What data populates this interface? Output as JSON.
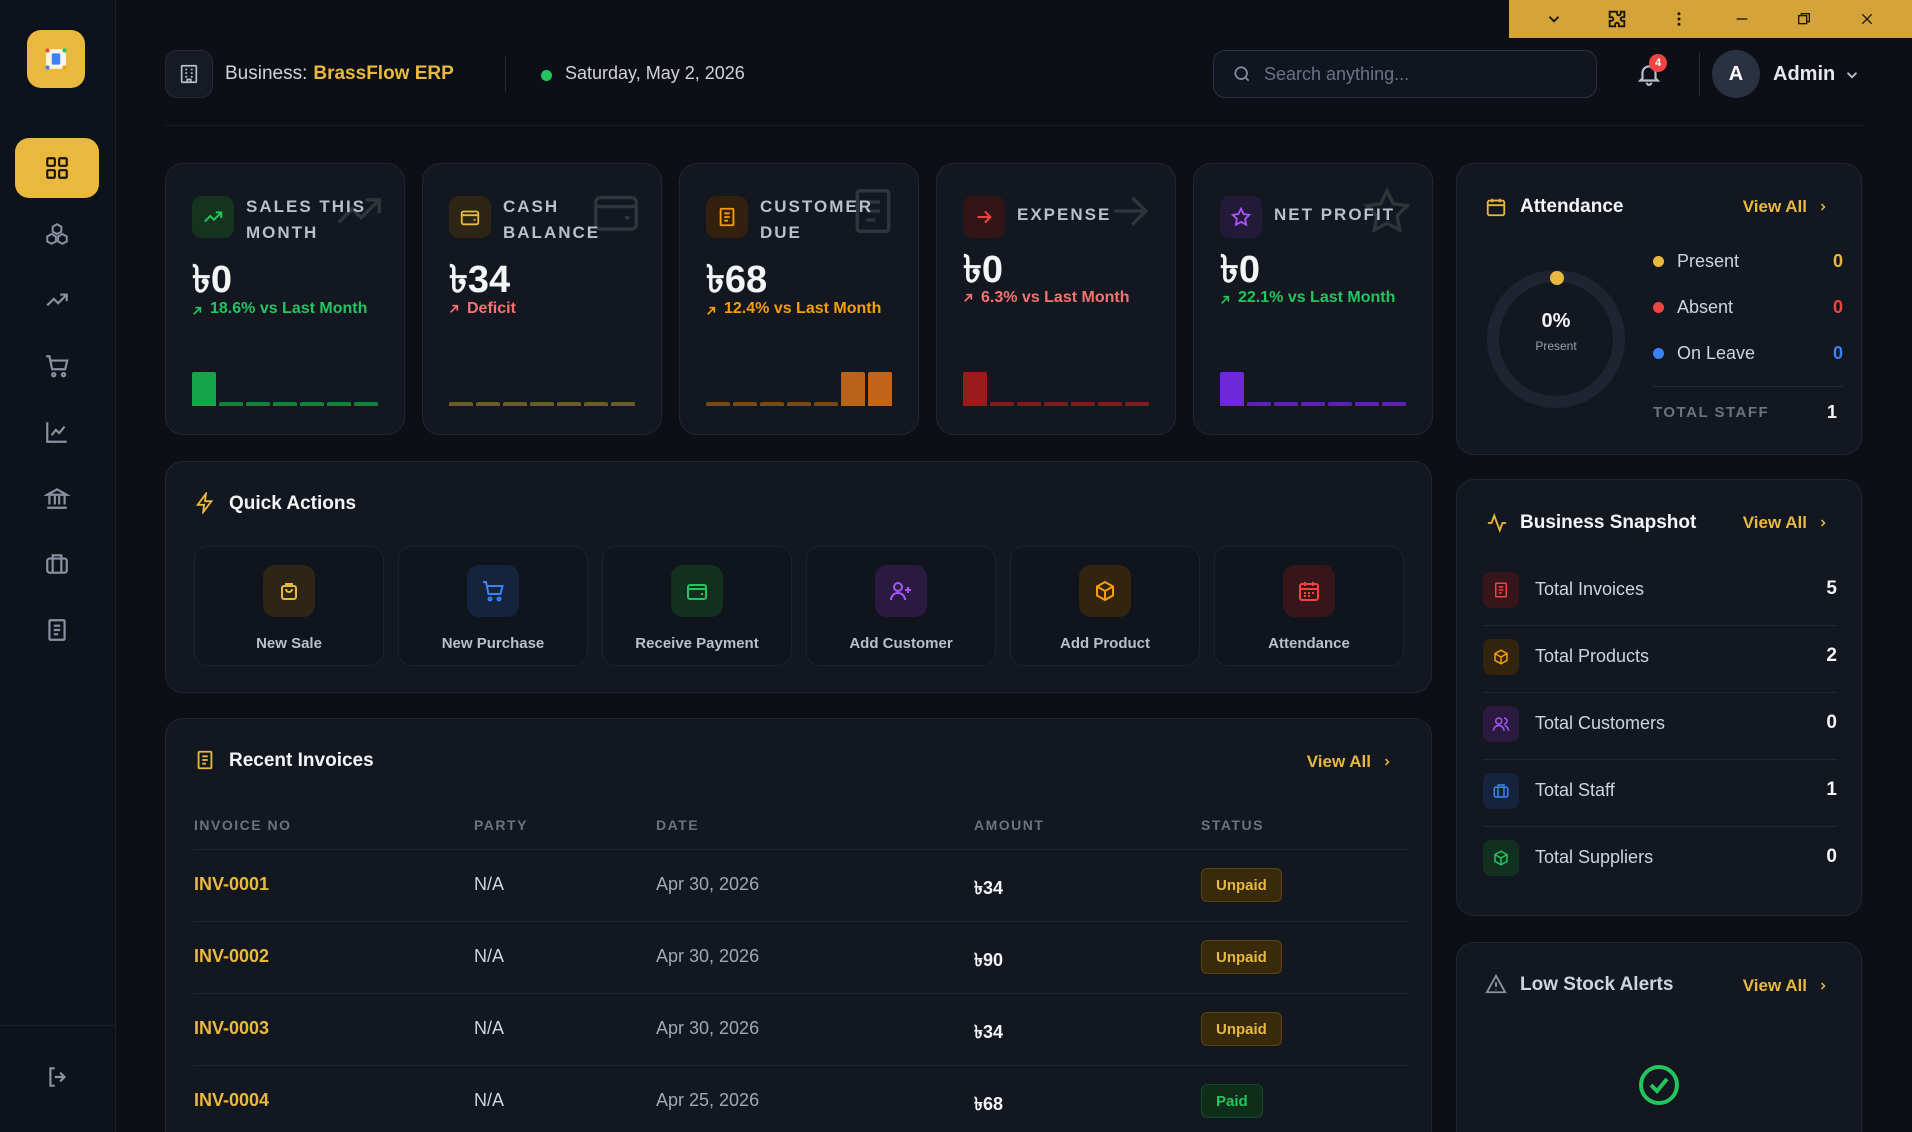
{
  "window": {
    "controls": [
      "chevron-down-icon",
      "extension-icon",
      "more-vert-icon",
      "minimize-icon",
      "restore-icon",
      "close-icon"
    ]
  },
  "sidebar": {
    "items": [
      "dashboard-icon",
      "inventory-icon",
      "sales-trend-icon",
      "purchase-cart-icon",
      "reports-chart-icon",
      "bank-icon",
      "staff-briefcase-icon",
      "invoice-doc-icon"
    ],
    "active_index": 0,
    "logout": "logout-icon"
  },
  "header": {
    "business_label": "Business:",
    "business_name": "BrassFlow ERP",
    "date": "Saturday, May 2, 2026",
    "search_placeholder": "Search anything...",
    "notification_count": "4",
    "avatar_letter": "A",
    "user_name": "Admin"
  },
  "stats": [
    {
      "label": "SALES THIS MONTH",
      "value": "৳0",
      "change": "18.6% vs Last Month",
      "change_color": "#22c55e",
      "accent": "#22c55e"
    },
    {
      "label": "CASH BALANCE",
      "value": "৳34",
      "change": "Deficit",
      "change_color": "#f87171",
      "accent": "#a1883f"
    },
    {
      "label": "CUSTOMER DUE",
      "value": "৳68",
      "change": "12.4% vs Last Month",
      "change_color": "#f59e0b",
      "accent": "#f59e0b"
    },
    {
      "label": "EXPENSE",
      "value": "৳0",
      "change": "6.3% vs Last Month",
      "change_color": "#f87171",
      "accent": "#ef4444"
    },
    {
      "label": "NET PROFIT",
      "value": "৳0",
      "change": "22.1% vs Last Month",
      "change_color": "#22c55e",
      "accent": "#8b5cf6"
    }
  ],
  "quick_actions": {
    "title": "Quick Actions",
    "items": [
      {
        "label": "New Sale",
        "color": "#e8b93e"
      },
      {
        "label": "New Purchase",
        "color": "#3b82f6"
      },
      {
        "label": "Receive Payment",
        "color": "#22c55e"
      },
      {
        "label": "Add Customer",
        "color": "#a855f7"
      },
      {
        "label": "Add Product",
        "color": "#f59e0b"
      },
      {
        "label": "Attendance",
        "color": "#ef4444"
      }
    ]
  },
  "invoices": {
    "title": "Recent Invoices",
    "view_all": "View All",
    "columns": [
      "INVOICE NO",
      "PARTY",
      "DATE",
      "AMOUNT",
      "STATUS"
    ],
    "rows": [
      {
        "no": "INV-0001",
        "party": "N/A",
        "date": "Apr 30, 2026",
        "amount": "৳34",
        "status": "Unpaid"
      },
      {
        "no": "INV-0002",
        "party": "N/A",
        "date": "Apr 30, 2026",
        "amount": "৳90",
        "status": "Unpaid"
      },
      {
        "no": "INV-0003",
        "party": "N/A",
        "date": "Apr 30, 2026",
        "amount": "৳34",
        "status": "Unpaid"
      },
      {
        "no": "INV-0004",
        "party": "N/A",
        "date": "Apr 25, 2026",
        "amount": "৳68",
        "status": "Paid"
      }
    ]
  },
  "attendance": {
    "title": "Attendance",
    "view_all": "View All",
    "percent": "0%",
    "percent_label": "Present",
    "legend": [
      {
        "label": "Present",
        "value": "0",
        "color": "#e8b93e"
      },
      {
        "label": "Absent",
        "value": "0",
        "color": "#ef4444"
      },
      {
        "label": "On Leave",
        "value": "0",
        "color": "#3b82f6"
      }
    ],
    "total_staff_label": "TOTAL STAFF",
    "total_staff": "1"
  },
  "snapshot": {
    "title": "Business Snapshot",
    "view_all": "View All",
    "rows": [
      {
        "label": "Total Invoices",
        "value": "5",
        "color": "#ef4444"
      },
      {
        "label": "Total Products",
        "value": "2",
        "color": "#f59e0b"
      },
      {
        "label": "Total Customers",
        "value": "0",
        "color": "#a855f7"
      },
      {
        "label": "Total Staff",
        "value": "1",
        "color": "#3b82f6"
      },
      {
        "label": "Total Suppliers",
        "value": "0",
        "color": "#22c55e"
      }
    ]
  },
  "low_stock": {
    "title": "Low Stock Alerts",
    "view_all": "View All"
  }
}
